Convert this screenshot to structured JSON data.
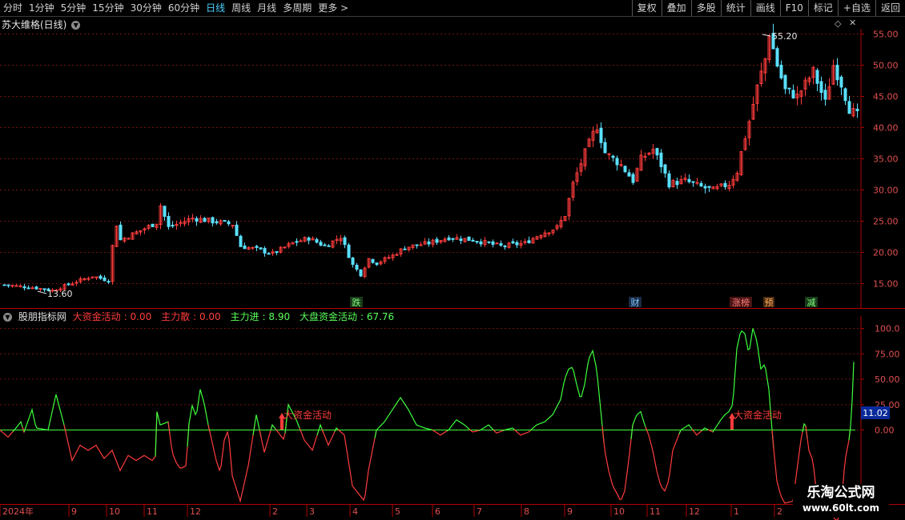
{
  "toolbar": {
    "left": [
      "分时",
      "1分钟",
      "5分钟",
      "15分钟",
      "30分钟",
      "60分钟",
      "日线",
      "周线",
      "月线",
      "多周期",
      "更多 >"
    ],
    "active": "日线",
    "right": [
      "复权",
      "叠加",
      "多股",
      "统计",
      "画线",
      "F10",
      "标记",
      "+自选",
      "返回"
    ]
  },
  "main_panel": {
    "title": "苏大维格(日线)",
    "y_ticks": [
      "55.00",
      "50.00",
      "45.00",
      "40.00",
      "35.00",
      "30.00",
      "25.00",
      "20.00",
      "15.00"
    ],
    "max_label": "55.20",
    "min_label": "13.60",
    "event_tags": [
      "跌",
      "财",
      "涨榜",
      "预",
      "减"
    ]
  },
  "sub_panel": {
    "title": "股朋指标网",
    "items": [
      {
        "label": "大资金活动",
        "value": "0.00",
        "color": "#ff3c3c"
      },
      {
        "label": "主力散",
        "value": "0.00",
        "color": "#ff3c3c"
      },
      {
        "label": "主力进",
        "value": "8.90",
        "color": "#5aff5a"
      },
      {
        "label": "大盘资金活动",
        "value": "67.76",
        "color": "#5aff5a"
      }
    ],
    "y_ticks": [
      "100.0",
      "75.00",
      "50.00",
      "25.00",
      "0.00"
    ],
    "current_value": "11.02",
    "annotations": [
      "大资金活动",
      "大资金活动"
    ]
  },
  "x_axis": [
    "2024年",
    "9",
    "10",
    "11",
    "12",
    "2",
    "3",
    "4",
    "5",
    "6",
    "7",
    "8",
    "9",
    "10",
    "11",
    "12",
    "1",
    "2"
  ],
  "watermark": {
    "line1": "乐淘公式网",
    "line2": "www.60lt.com"
  },
  "colors": {
    "up": "#ff3c3c",
    "down": "#5ae0ff",
    "grid": "#6e1414",
    "axis": "#b00000",
    "green": "#3cff3c"
  }
}
